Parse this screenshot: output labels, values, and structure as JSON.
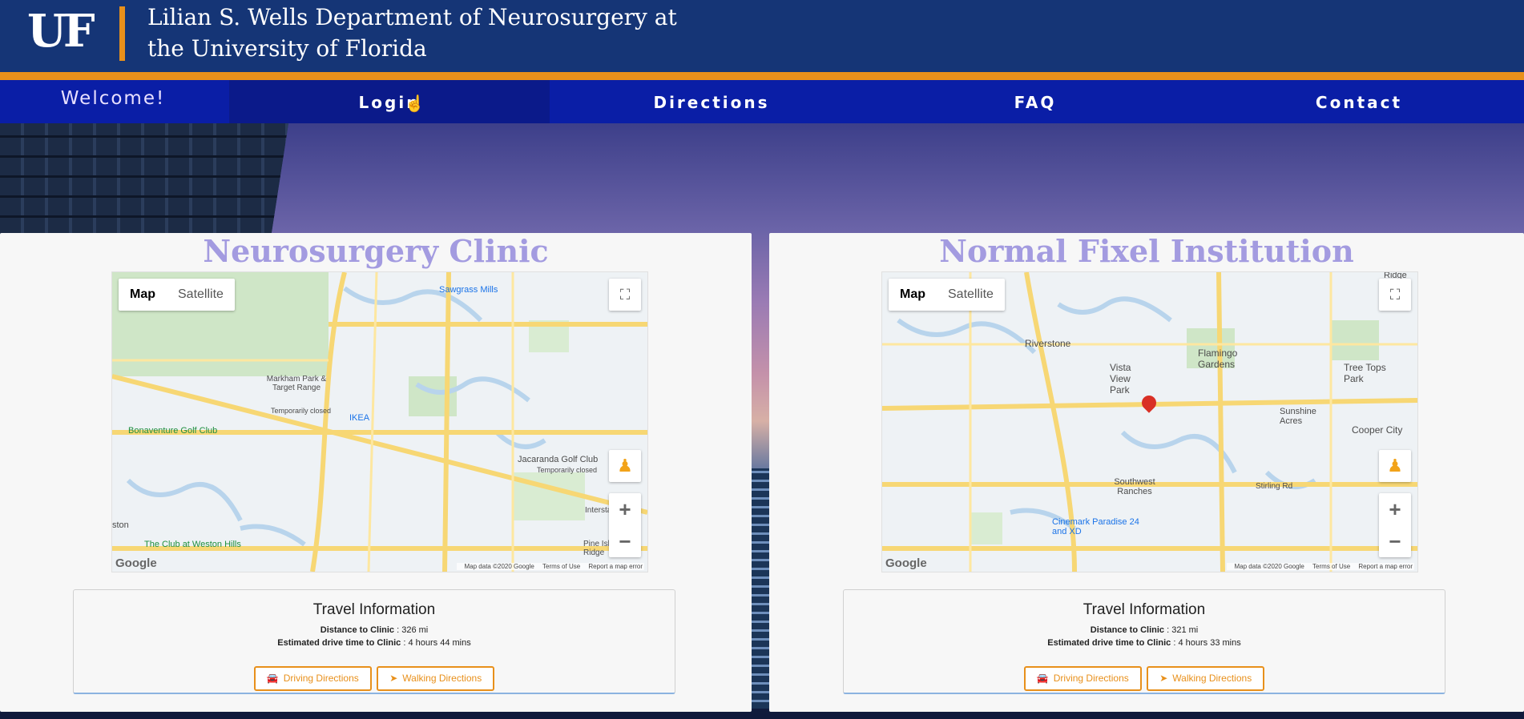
{
  "header": {
    "logo_text": "UF",
    "title": "Lilian S. Wells Department of Neurosurgery at the University of Florida"
  },
  "nav": {
    "welcome": "Welcome!",
    "items": [
      "Login",
      "Directions",
      "FAQ",
      "Contact"
    ]
  },
  "colors": {
    "header_bg": "#153576",
    "accent_orange": "#e8901b",
    "nav_bg": "#0a1ea6",
    "card_title": "#a39be0"
  },
  "map_controls": {
    "map_label": "Map",
    "satellite_label": "Satellite",
    "fullscreen_icon": "fullscreen-icon",
    "pegman_icon": "pegman-icon",
    "zoom_in": "+",
    "zoom_out": "−",
    "google_logo": "Google",
    "map_data": "Map data ©2020 Google",
    "terms": "Terms of Use",
    "report": "Report a map error"
  },
  "clinics": [
    {
      "title": "Neurosurgery Clinic",
      "map_labels": {
        "sawgrass": "Sawgrass Mills",
        "markham": "Markham Park & Target Range",
        "markham_sub": "Temporarily closed",
        "ikea": "IKEA",
        "bonaventure": "Bonaventure Golf Club",
        "jacaranda": "Jacaranda Golf Club",
        "jacaranda_sub": "Temporarily closed",
        "weston": "The Club at Weston Hills",
        "ston": "ston",
        "pine": "Pine Isla Ridge",
        "interstate": "Interstate"
      },
      "travel": {
        "heading": "Travel Information",
        "distance_label": "Distance to Clinic",
        "distance_value": ": 326 mi",
        "time_label": "Estimated drive time to Clinic",
        "time_value": ": 4 hours 44 mins",
        "driving": "Driving Directions",
        "walking": "Walking Directions"
      }
    },
    {
      "title": "Normal Fixel Institution",
      "map_labels": {
        "riverstone": "Riverstone",
        "vista": "Vista View Park",
        "flamingo": "Flamingo Gardens",
        "treetops": "Tree Tops Park",
        "sunshine": "Sunshine Acres",
        "cooper": "Cooper City",
        "southwest": "Southwest Ranches",
        "cinemark": "Cinemark Paradise 24 and XD",
        "stirling": "Stirling Rd",
        "ridge": "Ridge"
      },
      "travel": {
        "heading": "Travel Information",
        "distance_label": "Distance to Clinic",
        "distance_value": ": 321 mi",
        "time_label": "Estimated drive time to Clinic",
        "time_value": ": 4 hours 33 mins",
        "driving": "Driving Directions",
        "walking": "Walking Directions"
      }
    }
  ]
}
